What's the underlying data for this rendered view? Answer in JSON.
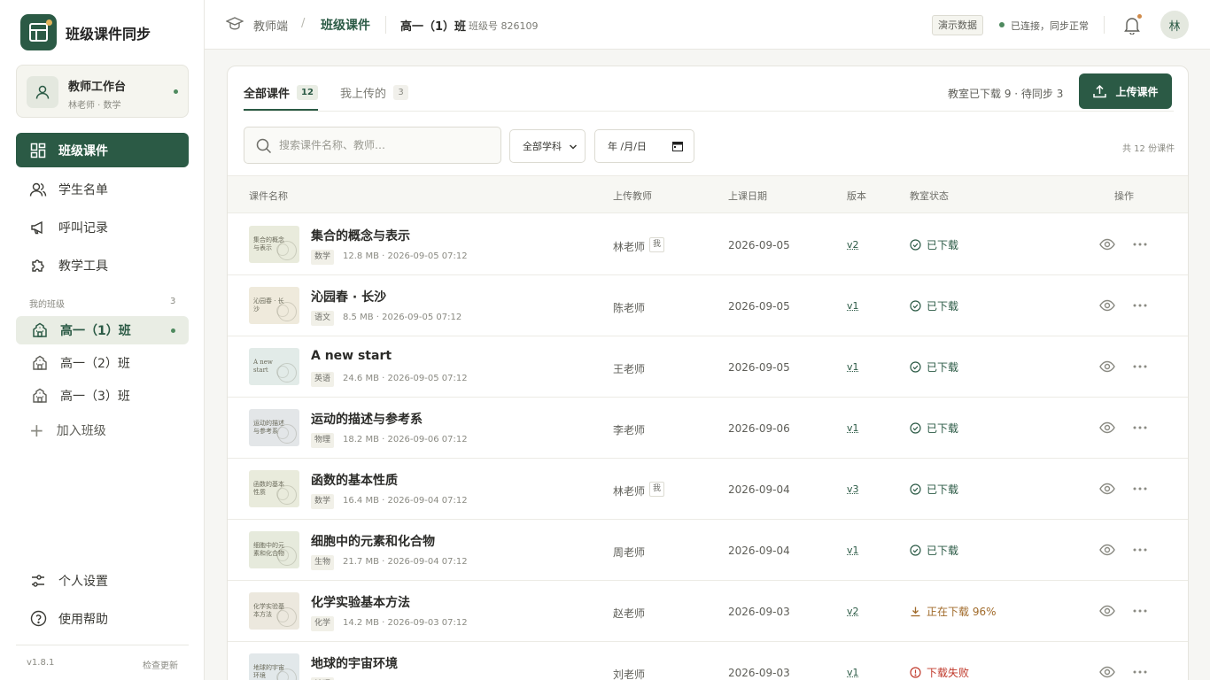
{
  "app": {
    "title": "班级课件同步"
  },
  "profile": {
    "name": "教师工作台",
    "subtitle": "林老师 · 数学"
  },
  "nav": {
    "items": [
      {
        "label": "班级课件",
        "icon": "grid-icon",
        "active": true
      },
      {
        "label": "学生名单",
        "icon": "users-icon",
        "active": false
      },
      {
        "label": "呼叫记录",
        "icon": "megaphone-icon",
        "active": false
      },
      {
        "label": "教学工具",
        "icon": "puzzle-icon",
        "active": false
      }
    ]
  },
  "classes": {
    "section_label": "我的班级",
    "count": "3",
    "items": [
      {
        "label": "高一（1）班",
        "active": true
      },
      {
        "label": "高一（2）班",
        "active": false
      },
      {
        "label": "高一（3）班",
        "active": false
      }
    ],
    "join_label": "加入班级"
  },
  "footer_nav": {
    "settings_label": "个人设置",
    "help_label": "使用帮助",
    "version": "v1.8.1",
    "check_update": "检查更新"
  },
  "topbar": {
    "breadcrumb_root": "教师端",
    "breadcrumb_sep": "/",
    "breadcrumb_current": "班级课件",
    "class_name": "高一（1）班",
    "class_no": "班级号 826109",
    "demo_badge": "演示数据",
    "connection": "已连接，同步正常",
    "user_initial": "林"
  },
  "tabs": {
    "all_label": "全部课件",
    "all_count": "12",
    "mine_label": "我上传的",
    "mine_count": "3"
  },
  "sync_status": "教室已下载 9 · 待同步 3",
  "upload_button": "上传课件",
  "search": {
    "placeholder": "搜索课件名称、教师…"
  },
  "filters": {
    "subject": "全部学科",
    "date": "年 /月/日"
  },
  "total": "共 12 份课件",
  "table": {
    "headers": [
      "课件名称",
      "上传教师",
      "上课日期",
      "版本",
      "教室状态",
      "操作"
    ],
    "me_tag": "我",
    "rows": [
      {
        "thumb": "集合的概念与表示",
        "title": "集合的概念与表示",
        "subject": "数学",
        "meta": "12.8 MB · 2026-09-05 07:12",
        "teacher": "林老师",
        "is_me": true,
        "date": "2026-09-05",
        "version": "v2",
        "status": "已下载",
        "status_type": "done",
        "thumb_color": "#e9ebdc"
      },
      {
        "thumb": "沁园春 · 长沙",
        "title": "沁园春 · 长沙",
        "subject": "语文",
        "meta": "8.5 MB · 2026-09-05 07:12",
        "teacher": "陈老师",
        "is_me": false,
        "date": "2026-09-05",
        "version": "v1",
        "status": "已下载",
        "status_type": "done",
        "thumb_color": "#efeadc"
      },
      {
        "thumb": "A new start",
        "title": "A new start",
        "subject": "英语",
        "meta": "24.6 MB · 2026-09-05 07:12",
        "teacher": "王老师",
        "is_me": false,
        "date": "2026-09-05",
        "version": "v1",
        "status": "已下载",
        "status_type": "done",
        "thumb_color": "#e2ebe8"
      },
      {
        "thumb": "运动的描述与参考系",
        "title": "运动的描述与参考系",
        "subject": "物理",
        "meta": "18.2 MB · 2026-09-06 07:12",
        "teacher": "李老师",
        "is_me": false,
        "date": "2026-09-06",
        "version": "v1",
        "status": "已下载",
        "status_type": "done",
        "thumb_color": "#e3e6e8"
      },
      {
        "thumb": "函数的基本性质",
        "title": "函数的基本性质",
        "subject": "数学",
        "meta": "16.4 MB · 2026-09-04 07:12",
        "teacher": "林老师",
        "is_me": true,
        "date": "2026-09-04",
        "version": "v3",
        "status": "已下载",
        "status_type": "done",
        "thumb_color": "#e9ebdc"
      },
      {
        "thumb": "细胞中的元素和化合物",
        "title": "细胞中的元素和化合物",
        "subject": "生物",
        "meta": "21.7 MB · 2026-09-04 07:12",
        "teacher": "周老师",
        "is_me": false,
        "date": "2026-09-04",
        "version": "v1",
        "status": "已下载",
        "status_type": "done",
        "thumb_color": "#e6eadc"
      },
      {
        "thumb": "化学实验基本方法",
        "title": "化学实验基本方法",
        "subject": "化学",
        "meta": "14.2 MB · 2026-09-03 07:12",
        "teacher": "赵老师",
        "is_me": false,
        "date": "2026-09-03",
        "version": "v2",
        "status": "正在下载 96%",
        "status_type": "downloading",
        "thumb_color": "#ece8de"
      },
      {
        "thumb": "地球的宇宙环境",
        "title": "地球的宇宙环境",
        "subject": "地理",
        "meta": "",
        "teacher": "刘老师",
        "is_me": false,
        "date": "2026-09-03",
        "version": "v1",
        "status": "下载失败",
        "status_type": "failed",
        "thumb_color": "#e2e8ea"
      }
    ]
  }
}
